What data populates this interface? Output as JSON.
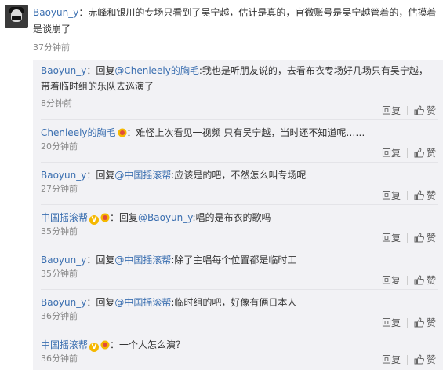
{
  "main_comment": {
    "username": "Baoyun_y",
    "text": "：赤峰和银川的专场只看到了吴宁越，估计是真的，官微账号是吴宁越管着的，估摸着是谈崩了",
    "time": "37分钟前"
  },
  "replies": [
    {
      "username": "Baoyun_y",
      "prefix": "：回复",
      "mention": "@Chenleely的胸毛",
      "text": ":我也是听朋友说的，去看布衣专场好几场只有吴宁越，带着临时组的乐队去巡演了",
      "time": "8分钟前",
      "reply_label": "回复",
      "like_label": "赞"
    },
    {
      "username": "Chenleely的胸毛",
      "prefix": "",
      "mention": "",
      "text": "：难怪上次看见一视频 只有吴宁越，当时还不知道呢……",
      "time": "20分钟前",
      "reply_label": "回复",
      "like_label": "赞"
    },
    {
      "username": "Baoyun_y",
      "prefix": "：回复",
      "mention": "@中国摇滚帮",
      "text": ":应该是的吧，不然怎么叫专场呢",
      "time": "27分钟前",
      "reply_label": "回复",
      "like_label": "赞"
    },
    {
      "username": "中国摇滚帮",
      "prefix": "：回复",
      "mention": "@Baoyun_y",
      "text": ":唱的是布衣的歌吗",
      "time": "35分钟前",
      "reply_label": "回复",
      "like_label": "赞"
    },
    {
      "username": "Baoyun_y",
      "prefix": "：回复",
      "mention": "@中国摇滚帮",
      "text": ":除了主唱每个位置都是临时工",
      "time": "35分钟前",
      "reply_label": "回复",
      "like_label": "赞"
    },
    {
      "username": "Baoyun_y",
      "prefix": "：回复",
      "mention": "@中国摇滚帮",
      "text": ":临时组的吧，好像有俩日本人",
      "time": "36分钟前",
      "reply_label": "回复",
      "like_label": "赞"
    },
    {
      "username": "中国摇滚帮",
      "prefix": "",
      "mention": "",
      "text": "：一个人怎么演？",
      "time": "36分钟前",
      "reply_label": "回复",
      "like_label": "赞"
    }
  ],
  "colors": {
    "link": "#3b6fb0",
    "reply_bg": "#f2f2f5",
    "vip": "#f5b800"
  }
}
